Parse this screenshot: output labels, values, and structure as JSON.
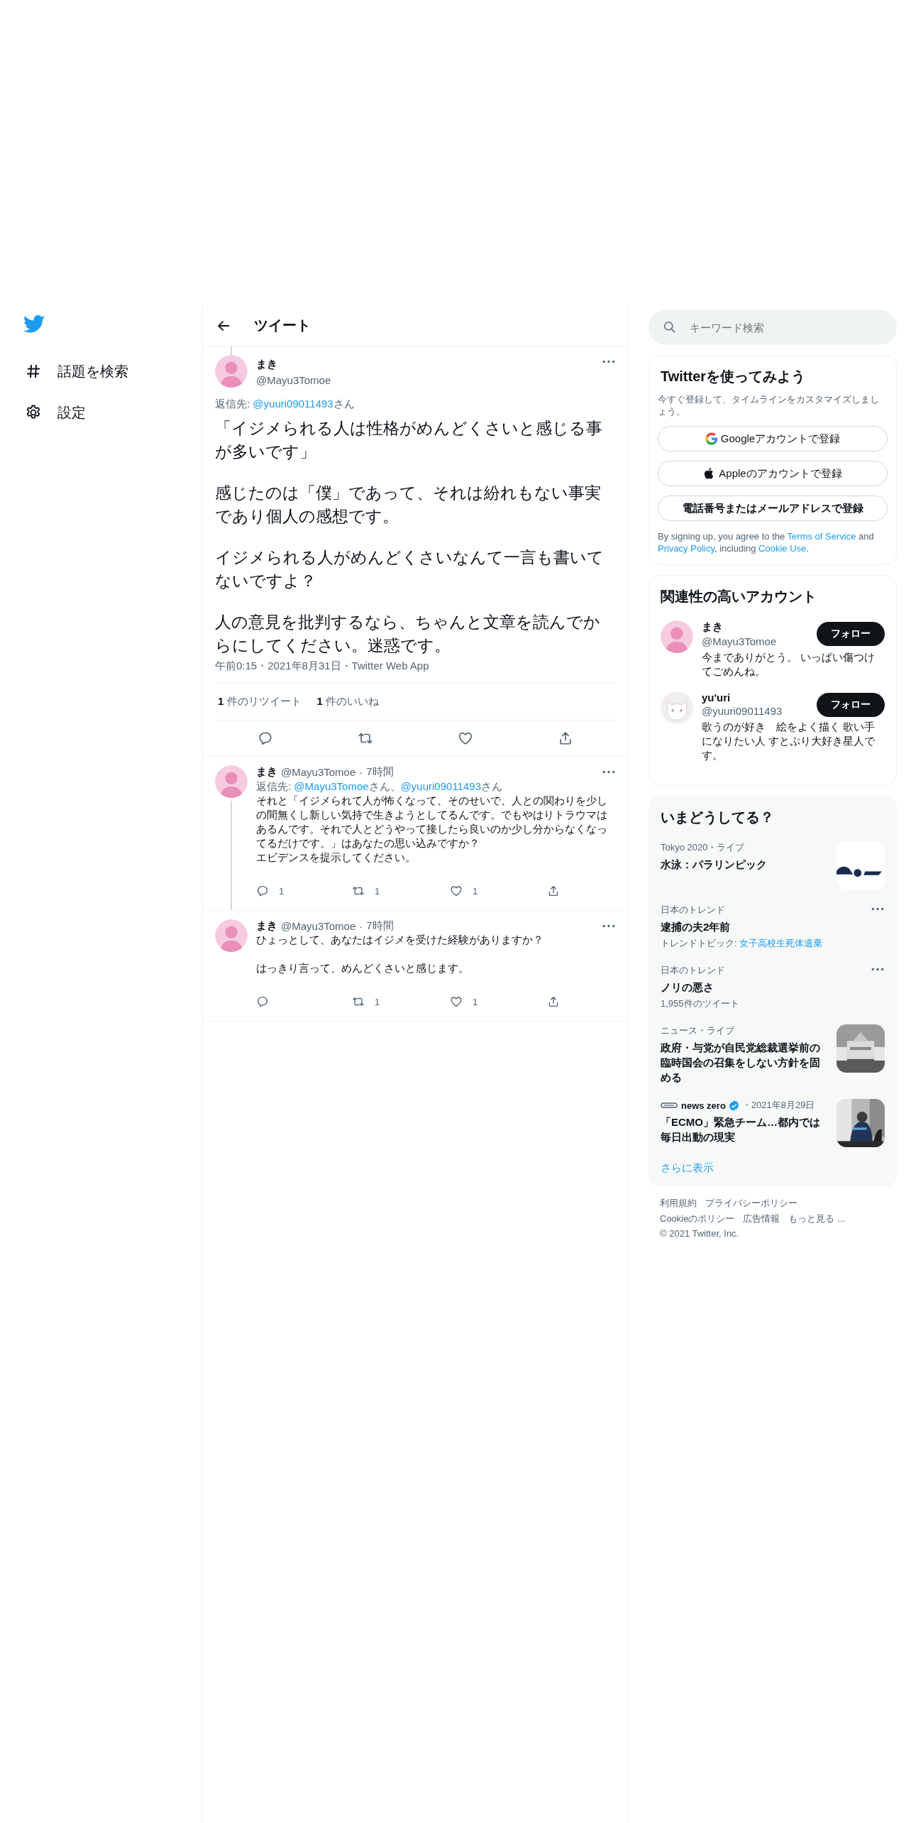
{
  "nav": {
    "items": [
      {
        "kind": "hashtag",
        "label": "話題を検索"
      },
      {
        "kind": "gear",
        "label": "設定"
      }
    ]
  },
  "header": {
    "title": "ツイート"
  },
  "main_tweet": {
    "name": "まき",
    "handle": "@Mayu3Tomoe",
    "thread_line_above": true,
    "reply_to": [
      {
        "text": "返信先: ",
        "link": false
      },
      {
        "text": "@yuuri09011493",
        "link": true
      },
      {
        "text": "さん",
        "link": false
      }
    ],
    "paragraphs": [
      "「イジメられる人は性格がめんどくさいと感じる事が多いです」",
      "感じたのは「僕」であって、それは紛れもない事実であり個人の感想です。",
      "イジメられる人がめんどくさいなんて一言も書いてないですよ？",
      "人の意見を批判するなら、ちゃんと文章を読んでからにしてください。迷惑です。"
    ],
    "meta": "午前0:15・2021年8月31日・Twitter Web App",
    "stats": [
      {
        "count": "1",
        "label": "件のリツイート"
      },
      {
        "count": "1",
        "label": "件のいいね"
      }
    ],
    "actions": [
      {
        "kind": "reply"
      },
      {
        "kind": "retweet"
      },
      {
        "kind": "like"
      },
      {
        "kind": "share"
      }
    ]
  },
  "replies": [
    {
      "name": "まき",
      "handle": "@Mayu3Tomoe",
      "time": "7時間",
      "thread_line_below": true,
      "reply_to": [
        {
          "text": "返信先: ",
          "link": false
        },
        {
          "text": "@Mayu3Tomoe",
          "link": true
        },
        {
          "text": "さん、",
          "link": false
        },
        {
          "text": "@yuuri09011493",
          "link": true
        },
        {
          "text": "さん",
          "link": false
        }
      ],
      "separator": "·",
      "paragraphs": [
        [
          "それと「イジメられて人が怖くなって、そのせいで、人との関わりを少しの間無くし新しい気持で生きようとしてるんです。でもやはりトラウマはあるんです。それで人とどうやって接したら良いのか少し分からなくなってるだけです。」はあなたの思い込みですか？",
          "エビデンスを提示してください。"
        ]
      ],
      "actions": [
        {
          "kind": "reply",
          "count": "1"
        },
        {
          "kind": "retweet",
          "count": "1"
        },
        {
          "kind": "like",
          "count": "1"
        },
        {
          "kind": "share"
        }
      ]
    },
    {
      "name": "まき",
      "handle": "@Mayu3Tomoe",
      "time": "7時間",
      "thread_line_below": false,
      "separator": "·",
      "paragraphs": [
        [
          "ひょっとして、あなたはイジメを受けた経験がありますか？"
        ],
        [
          "はっきり言って、めんどくさいと感じます。"
        ]
      ],
      "actions": [
        {
          "kind": "reply"
        },
        {
          "kind": "retweet",
          "count": "1"
        },
        {
          "kind": "like",
          "count": "1"
        },
        {
          "kind": "share"
        }
      ]
    }
  ],
  "search": {
    "placeholder": "キーワード検索"
  },
  "signup": {
    "title": "Twitterを使ってみよう",
    "subtitle": "今すぐ登録して、タイムラインをカスタマイズしましょう。",
    "buttons": [
      {
        "kind": "google",
        "label": "Googleアカウントで登録"
      },
      {
        "kind": "apple",
        "label": "Appleのアカウントで登録"
      },
      {
        "kind": "phone",
        "label": "電話番号またはメールアドレスで登録"
      }
    ],
    "legal": [
      {
        "text": "By signing up, you agree to the ",
        "link": false
      },
      {
        "text": "Terms of Service",
        "link": true
      },
      {
        "text": " and ",
        "link": false
      },
      {
        "text": "Privacy Policy",
        "link": true
      },
      {
        "text": ", including ",
        "link": false
      },
      {
        "text": "Cookie Use",
        "link": true
      },
      {
        "text": ".",
        "link": false
      }
    ]
  },
  "accounts": {
    "title": "関連性の高いアカウント",
    "items": [
      {
        "name": "まき",
        "handle": "@Mayu3Tomoe",
        "bio": "今までありがとう。 いっぱい傷つけてごめんね。",
        "button": "フォロー",
        "kind": "pink"
      },
      {
        "name": "yu'uri",
        "handle": "@yuuri09011493",
        "bio": "歌うのが好き　絵をよく描く 歌い手になりたい人 すとぷり大好き星人です。",
        "button": "フォロー",
        "kind": "cat"
      }
    ]
  },
  "trends": {
    "title": "いまどうしてる？",
    "items": [
      {
        "context": "Tokyo 2020・ライブ",
        "title": "水泳：パラリンピック",
        "more": false,
        "picture": true
      },
      {
        "context": "日本のトレンド",
        "title": "逮捕の夫2年前",
        "picture": false,
        "topic_label": "トレンドトピック: ",
        "topic_link": "女子高校生死体遺棄",
        "more": true
      },
      {
        "context": "日本のトレンド",
        "title": "ノリの悪さ",
        "count": "1,955件のツイート",
        "more": true,
        "picture": false
      },
      {
        "context": "ニュース・ライブ",
        "title": "政府・与党が自民党総裁選挙前の臨時国会の召集をしない方針を固める",
        "more": false,
        "picture": true
      },
      {
        "source": "news zero",
        "verified": true,
        "context": "・2021年8月29日",
        "title": "「ECMO」緊急チーム…都内では毎日出動の現実",
        "more": false,
        "picture": true
      }
    ],
    "show_more": "さらに表示"
  },
  "footer": {
    "links": [
      "利用規約",
      "プライバシーポリシー",
      "Cookieのポリシー",
      "広告情報",
      "もっと見る ..."
    ],
    "copyright": "© 2021 Twitter, Inc."
  }
}
